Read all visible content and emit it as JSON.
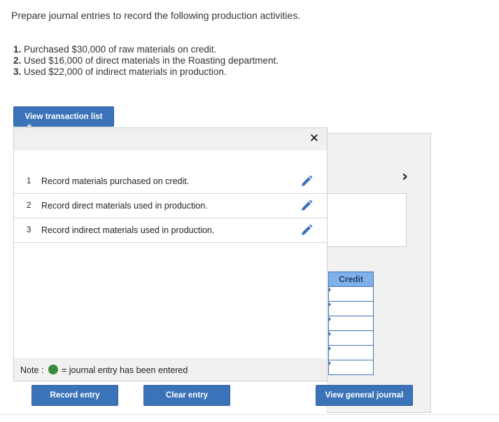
{
  "instructions": {
    "intro": "Prepare journal entries to record the following production activities.",
    "steps": [
      {
        "num": "1.",
        "text": "Purchased $30,000 of raw materials on credit."
      },
      {
        "num": "2.",
        "text": "Used $16,000 of direct materials in the Roasting department."
      },
      {
        "num": "3.",
        "text": "Used $22,000 of indirect materials in production."
      }
    ]
  },
  "toolbar": {
    "view_transaction_list": "View transaction list"
  },
  "popup": {
    "close_glyph": "✕",
    "transactions": [
      {
        "num": "1",
        "label": "Record materials purchased on credit."
      },
      {
        "num": "2",
        "label": "Record direct materials used in production."
      },
      {
        "num": "3",
        "label": "Record indirect materials used in production."
      }
    ],
    "note": {
      "label": "Note :",
      "text": "= journal entry has been entered",
      "dot_color": "#3e8a3c"
    },
    "row_icon": "pencil-icon"
  },
  "journal": {
    "credit_header": "Credit",
    "next_glyph": "›"
  },
  "buttons": {
    "record_entry": "Record entry",
    "clear_entry": "Clear entry",
    "view_general_journal": "View general journal"
  },
  "colors": {
    "accent": "#3b73b9",
    "header_cell": "#7fb0e8"
  }
}
